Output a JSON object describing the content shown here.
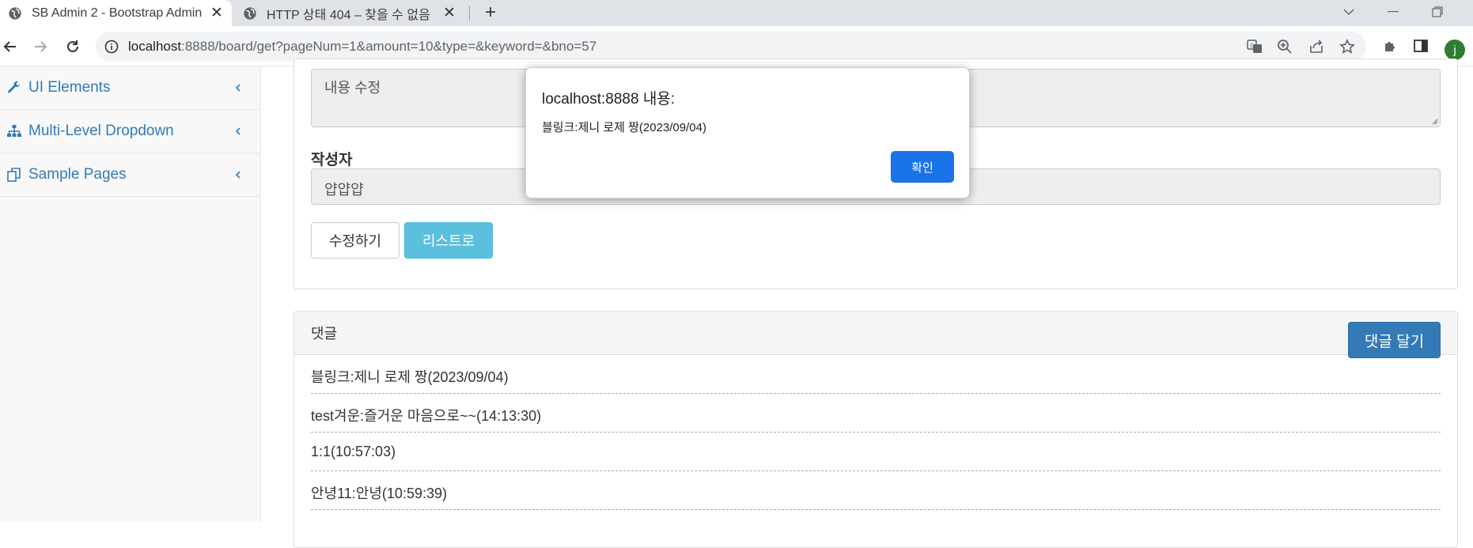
{
  "browser": {
    "tabs": [
      {
        "title": "SB Admin 2 - Bootstrap Admin",
        "close": "✕"
      },
      {
        "title": "HTTP 상태 404 – 찾을 수 없음",
        "close": "✕"
      }
    ],
    "new_tab": "+",
    "address": {
      "host": "localhost",
      "rest": ":8888/board/get?pageNum=1&amount=10&type=&keyword=&bno=57"
    },
    "profile_initial": "j",
    "colors": {
      "profile": "#2e7d32",
      "tab_strip": "#dfe3e8"
    }
  },
  "sidebar": {
    "items": [
      {
        "label": "UI Elements",
        "icon": "wrench-icon"
      },
      {
        "label": "Multi-Level Dropdown",
        "icon": "sitemap-icon"
      },
      {
        "label": "Sample Pages",
        "icon": "files-icon"
      }
    ]
  },
  "form": {
    "content_placeholder": "내용 수정",
    "writer_label": "작성자",
    "writer_value": "얍얍얍",
    "modify_button": "수정하기",
    "list_button": "리스트로"
  },
  "replies": {
    "title": "댓글",
    "add_button": "댓글 달기",
    "items": [
      "블링크:제니 로제 짱(2023/09/04)",
      "test겨운:즐거운 마음으로~~(14:13:30)",
      "1:1(10:57:03)",
      "안녕11:안녕(10:59:39)"
    ]
  },
  "dialog": {
    "title": "localhost:8888 내용:",
    "message": "블링크:제니 로제 짱(2023/09/04)",
    "ok_button": "확인"
  }
}
